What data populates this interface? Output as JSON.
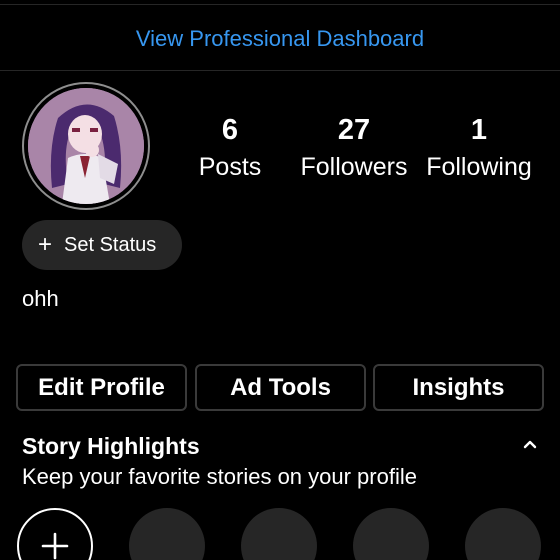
{
  "header": {
    "dashboard_link": "View Professional Dashboard"
  },
  "profile": {
    "stats": [
      {
        "value": "6",
        "label": "Posts"
      },
      {
        "value": "27",
        "label": "Followers"
      },
      {
        "value": "1",
        "label": "Following"
      }
    ],
    "status_button": {
      "icon": "plus-icon",
      "label": "Set Status"
    },
    "bio": "ohh"
  },
  "actions": {
    "edit_profile": "Edit Profile",
    "ad_tools": "Ad Tools",
    "insights": "Insights"
  },
  "highlights": {
    "title": "Story Highlights",
    "subtitle": "Keep your favorite stories on your profile",
    "collapse_icon": "chevron-up-icon",
    "new_icon": "plus-icon",
    "placeholder_count": 4
  },
  "colors": {
    "accent": "#3797f0",
    "background": "#000000",
    "surface": "#262626"
  }
}
